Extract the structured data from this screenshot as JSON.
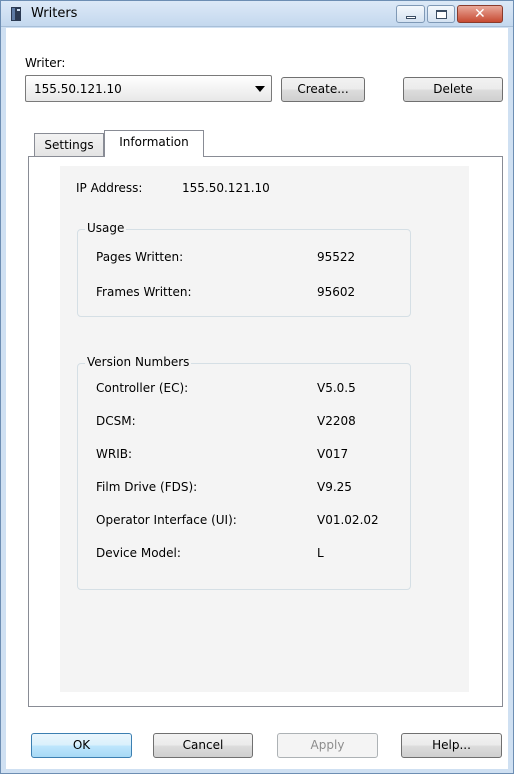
{
  "window": {
    "title": "Writers"
  },
  "writer": {
    "label": "Writer:",
    "selected": "155.50.121.10",
    "create_label": "Create...",
    "delete_label": "Delete"
  },
  "tabs": [
    {
      "label": "Settings",
      "active": false
    },
    {
      "label": "Information",
      "active": true
    }
  ],
  "info": {
    "ip_label": "IP Address:",
    "ip_value": "155.50.121.10",
    "usage": {
      "legend": "Usage",
      "rows": [
        {
          "label": "Pages Written:",
          "value": "95522"
        },
        {
          "label": "Frames Written:",
          "value": "95602"
        }
      ]
    },
    "versions": {
      "legend": "Version Numbers",
      "rows": [
        {
          "label": "Controller (EC):",
          "value": "V5.0.5"
        },
        {
          "label": "DCSM:",
          "value": "V2208"
        },
        {
          "label": "WRIB:",
          "value": "V017"
        },
        {
          "label": "Film Drive (FDS):",
          "value": "V9.25"
        },
        {
          "label": "Operator Interface (UI):",
          "value": "V01.02.02"
        },
        {
          "label": "Device Model:",
          "value": "L"
        }
      ]
    }
  },
  "footer": {
    "ok_label": "OK",
    "cancel_label": "Cancel",
    "apply_label": "Apply",
    "help_label": "Help..."
  }
}
